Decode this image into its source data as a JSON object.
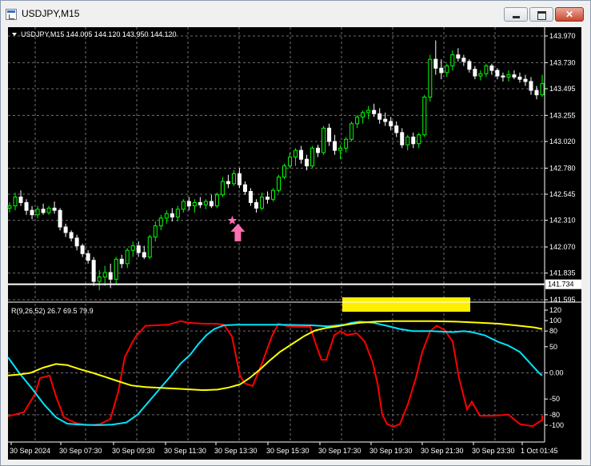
{
  "window": {
    "title": "USDJPY,M15",
    "app_icon": "chart-window-icon",
    "buttons": [
      "minimize-icon",
      "maximize-icon",
      "close-icon"
    ]
  },
  "price_chart": {
    "header": "USDJPY,M15  144.005 144.120 143.950 144.120",
    "y_ticks": [
      "143.970",
      "143.730",
      "143.495",
      "143.255",
      "143.020",
      "142.780",
      "142.545",
      "142.310",
      "142.070",
      "141.835",
      "141.595"
    ],
    "price_line_label": "141.734",
    "bull_color": "#00ff00",
    "bear_color": "#ffffff"
  },
  "indicator": {
    "header": "R(9,26,52) 26.7 69.5 79.9",
    "y_ticks": [
      "120",
      "100",
      "80",
      "50",
      "0.00",
      "-50",
      "-80",
      "-100"
    ],
    "colors": {
      "fast": "#ff0000",
      "mid": "#00e5ff",
      "slow": "#ffff00"
    }
  },
  "time_axis": [
    "30 Sep 2024",
    "30 Sep 07:30",
    "30 Sep 09:30",
    "30 Sep 11:30",
    "30 Sep 13:30",
    "30 Sep 15:30",
    "30 Sep 17:30",
    "30 Sep 19:30",
    "30 Sep 21:30",
    "30 Sep 23:30",
    "1 Oct 01:45"
  ],
  "chart_data": {
    "type": "candlestick",
    "symbol": "USDJPY",
    "timeframe": "M15",
    "ylim": [
      141.595,
      143.97
    ],
    "ohlc": [
      [
        142.42,
        142.47,
        142.38,
        142.44
      ],
      [
        142.44,
        142.56,
        142.4,
        142.52
      ],
      [
        142.52,
        142.58,
        142.44,
        142.47
      ],
      [
        142.47,
        142.5,
        142.36,
        142.4
      ],
      [
        142.4,
        142.44,
        142.32,
        142.36
      ],
      [
        142.36,
        142.44,
        142.33,
        142.41
      ],
      [
        142.41,
        142.46,
        142.36,
        142.38
      ],
      [
        142.38,
        142.44,
        142.36,
        142.42
      ],
      [
        142.42,
        142.48,
        142.37,
        142.4
      ],
      [
        142.4,
        142.42,
        142.22,
        142.25
      ],
      [
        142.25,
        142.28,
        142.16,
        142.2
      ],
      [
        142.2,
        142.22,
        142.12,
        142.15
      ],
      [
        142.15,
        142.18,
        142.04,
        142.08
      ],
      [
        142.08,
        142.1,
        141.98,
        142.01
      ],
      [
        142.01,
        142.04,
        141.92,
        141.95
      ],
      [
        141.95,
        141.98,
        141.72,
        141.76
      ],
      [
        141.76,
        141.86,
        141.68,
        141.8
      ],
      [
        141.8,
        141.9,
        141.72,
        141.84
      ],
      [
        141.84,
        141.92,
        141.7,
        141.78
      ],
      [
        141.78,
        141.98,
        141.74,
        141.96
      ],
      [
        141.96,
        142.0,
        141.88,
        141.92
      ],
      [
        141.92,
        142.06,
        141.88,
        142.04
      ],
      [
        142.04,
        142.12,
        141.98,
        142.08
      ],
      [
        142.08,
        142.12,
        141.98,
        142.02
      ],
      [
        142.02,
        142.08,
        141.96,
        141.98
      ],
      [
        141.98,
        142.18,
        141.96,
        142.16
      ],
      [
        142.16,
        142.3,
        142.12,
        142.26
      ],
      [
        142.26,
        142.36,
        142.22,
        142.33
      ],
      [
        142.33,
        142.4,
        142.28,
        142.37
      ],
      [
        142.37,
        142.42,
        142.3,
        142.34
      ],
      [
        142.34,
        142.44,
        142.3,
        142.41
      ],
      [
        142.41,
        142.5,
        142.38,
        142.48
      ],
      [
        142.48,
        142.52,
        142.4,
        142.44
      ],
      [
        142.44,
        142.5,
        142.38,
        142.47
      ],
      [
        142.47,
        142.52,
        142.42,
        142.45
      ],
      [
        142.45,
        142.5,
        142.41,
        142.48
      ],
      [
        142.48,
        142.54,
        142.42,
        142.44
      ],
      [
        142.44,
        142.56,
        142.42,
        142.54
      ],
      [
        142.54,
        142.7,
        142.52,
        142.66
      ],
      [
        142.66,
        142.72,
        142.6,
        142.64
      ],
      [
        142.64,
        142.76,
        142.62,
        142.73
      ],
      [
        142.73,
        142.78,
        142.6,
        142.63
      ],
      [
        142.63,
        142.66,
        142.54,
        142.57
      ],
      [
        142.57,
        142.6,
        142.44,
        142.47
      ],
      [
        142.47,
        142.5,
        142.38,
        142.42
      ],
      [
        142.42,
        142.56,
        142.4,
        142.52
      ],
      [
        142.52,
        142.57,
        142.46,
        142.5
      ],
      [
        142.5,
        142.6,
        142.48,
        142.58
      ],
      [
        142.58,
        142.72,
        142.56,
        142.7
      ],
      [
        142.7,
        142.82,
        142.68,
        142.8
      ],
      [
        142.8,
        142.92,
        142.78,
        142.88
      ],
      [
        142.88,
        142.96,
        142.8,
        142.94
      ],
      [
        142.94,
        142.98,
        142.82,
        142.86
      ],
      [
        142.86,
        142.9,
        142.76,
        142.8
      ],
      [
        142.8,
        142.98,
        142.78,
        142.96
      ],
      [
        142.96,
        142.99,
        142.88,
        142.92
      ],
      [
        142.92,
        143.16,
        142.9,
        143.14
      ],
      [
        143.14,
        143.18,
        142.98,
        143.02
      ],
      [
        143.02,
        143.08,
        142.9,
        142.94
      ],
      [
        142.94,
        142.99,
        142.86,
        142.96
      ],
      [
        142.96,
        143.06,
        142.92,
        143.04
      ],
      [
        143.04,
        143.2,
        143.02,
        143.18
      ],
      [
        143.18,
        143.26,
        143.14,
        143.24
      ],
      [
        143.24,
        143.3,
        143.18,
        143.28
      ],
      [
        143.28,
        143.34,
        143.22,
        143.3
      ],
      [
        143.3,
        143.36,
        143.24,
        143.27
      ],
      [
        143.27,
        143.32,
        143.18,
        143.22
      ],
      [
        143.22,
        143.28,
        143.16,
        143.2
      ],
      [
        143.2,
        143.24,
        143.12,
        143.16
      ],
      [
        143.16,
        143.2,
        143.06,
        143.1
      ],
      [
        143.1,
        143.14,
        142.96,
        142.99
      ],
      [
        142.99,
        143.08,
        142.94,
        143.06
      ],
      [
        143.06,
        143.1,
        142.96,
        143.0
      ],
      [
        143.0,
        143.1,
        142.96,
        143.08
      ],
      [
        143.08,
        143.44,
        143.06,
        143.42
      ],
      [
        143.42,
        143.8,
        143.38,
        143.76
      ],
      [
        143.76,
        143.93,
        143.62,
        143.68
      ],
      [
        143.68,
        143.76,
        143.58,
        143.64
      ],
      [
        143.64,
        143.72,
        143.6,
        143.7
      ],
      [
        143.7,
        143.84,
        143.66,
        143.8
      ],
      [
        143.8,
        143.86,
        143.74,
        143.77
      ],
      [
        143.77,
        143.8,
        143.7,
        143.74
      ],
      [
        143.74,
        143.76,
        143.64,
        143.67
      ],
      [
        143.67,
        143.7,
        143.58,
        143.61
      ],
      [
        143.61,
        143.66,
        143.57,
        143.63
      ],
      [
        143.63,
        143.72,
        143.6,
        143.7
      ],
      [
        143.7,
        143.72,
        143.62,
        143.66
      ],
      [
        143.66,
        143.68,
        143.58,
        143.61
      ],
      [
        143.61,
        143.64,
        143.56,
        143.6
      ],
      [
        143.6,
        143.66,
        143.56,
        143.62
      ],
      [
        143.62,
        143.66,
        143.58,
        143.6
      ],
      [
        143.6,
        143.64,
        143.55,
        143.58
      ],
      [
        143.58,
        143.62,
        143.52,
        143.56
      ],
      [
        143.56,
        143.6,
        143.44,
        143.48
      ],
      [
        143.48,
        143.52,
        143.4,
        143.44
      ],
      [
        143.44,
        143.62,
        143.42,
        143.54
      ]
    ],
    "price_line": 141.734,
    "buy_arrow": {
      "bar": 40,
      "price": 142.38
    },
    "indicator": {
      "name": "R(9,26,52)",
      "values": [
        26.7,
        69.5,
        79.9
      ],
      "ylim": [
        -120,
        120
      ],
      "levels": [
        80,
        0,
        -80
      ]
    }
  }
}
